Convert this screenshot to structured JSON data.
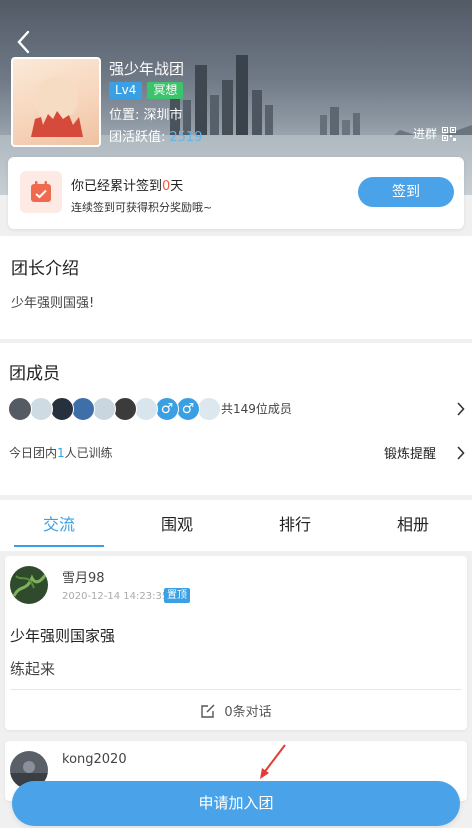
{
  "header": {
    "team_name": "强少年战团",
    "level_badge": "Lv4",
    "tag_badge": "冥想",
    "location": "位置: 深圳市",
    "activity_label": "团活跃值:",
    "activity_value": "2519",
    "join_group_label": "进群",
    "icons": {
      "back": "back-arrow-icon",
      "qr": "qr-code-icon"
    }
  },
  "signin": {
    "title_prefix": "你已经累计签到",
    "days": "0",
    "title_suffix": "天",
    "subtitle": "连续签到可获得积分奖励哦~",
    "button_label": "签到",
    "icon": "calendar-icon"
  },
  "intro": {
    "heading": "团长介绍",
    "text": "少年强则国强!"
  },
  "members": {
    "heading": "团成员",
    "count_text": "共149位成员",
    "today_prefix": "今日团内",
    "today_count": "1",
    "today_suffix": "人已训练",
    "remind_label": "锻炼提醒",
    "avatars": [
      {
        "color": "#555b62"
      },
      {
        "color": "#cfdbe3"
      },
      {
        "color": "#27303d"
      },
      {
        "color": "#3f6fa9"
      },
      {
        "color": "#c9d6df"
      },
      {
        "color": "#3b3b3b"
      },
      {
        "color": "#d9e5ec"
      },
      {
        "color": "#3aa0e3",
        "glyph": "♂"
      },
      {
        "color": "#3aa0e3",
        "glyph": "♂"
      },
      {
        "color": "#dce7ee"
      }
    ]
  },
  "tabs": [
    {
      "label": "交流",
      "active": true
    },
    {
      "label": "围观",
      "active": false
    },
    {
      "label": "排行",
      "active": false
    },
    {
      "label": "相册",
      "active": false
    }
  ],
  "posts": [
    {
      "user": "雪月98",
      "time": "2020-12-14 14:23:35",
      "pin": "置顶",
      "line1": "少年强则国家强",
      "line2": "练起来",
      "comments": "0条对话"
    },
    {
      "user": "kong2020"
    }
  ],
  "apply_button": "申请加入团",
  "colors": {
    "accent": "#3aa0e3",
    "button": "#4aa3e8",
    "highlight_red": "#f05b40",
    "tag_green": "#3cc46d"
  }
}
